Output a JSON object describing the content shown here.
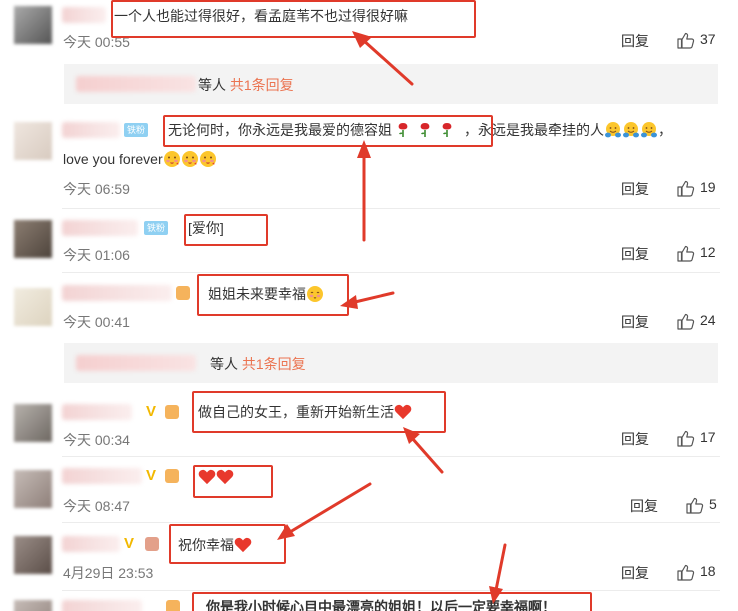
{
  "comments": [
    {
      "text": "一个人也能过得很好，看孟庭苇不也过得很好嘛",
      "time": "今天 00:55",
      "reply": "回复",
      "likes": "37"
    },
    {
      "badge": "铁粉",
      "text": "无论何时，你永远是我最爱的德容姐",
      "text_tail": "，永远是我最牵挂的人",
      "text_line2": "love you forever",
      "time": "今天 06:59",
      "reply": "回复",
      "likes": "19"
    },
    {
      "badge": "铁粉",
      "text": "[爱你]",
      "time": "今天 01:06",
      "reply": "回复",
      "likes": "12"
    },
    {
      "text": "姐姐未来要幸福",
      "time": "今天 00:41",
      "reply": "回复",
      "likes": "24"
    },
    {
      "vip": "V",
      "text": "做自己的女王，重新开始新生活",
      "time": "今天 00:34",
      "reply": "回复",
      "likes": "17"
    },
    {
      "vip": "V",
      "text": "",
      "time": "今天 08:47",
      "reply": "回复",
      "likes": "5"
    },
    {
      "vip": "V",
      "text": "祝你幸福",
      "time": "4月29日 23:53",
      "reply": "回复",
      "likes": "18"
    },
    {
      "text": "你是我小时候心目中最漂亮的姐姐！以后一定要幸福啊！"
    }
  ],
  "subreplies": [
    {
      "prefix": "等人",
      "link": "共1条回复"
    },
    {
      "prefix": "等人",
      "link": "共1条回复"
    }
  ],
  "colors": {
    "annotation": "#e03a2a",
    "link": "#eb7350",
    "vip": "#f2b800",
    "badge": "#8fd0f2"
  },
  "icons": {
    "like": "thumbs-up-icon",
    "rose": "rose-icon",
    "heart": "heart-icon",
    "hug": "hug-face-icon"
  }
}
